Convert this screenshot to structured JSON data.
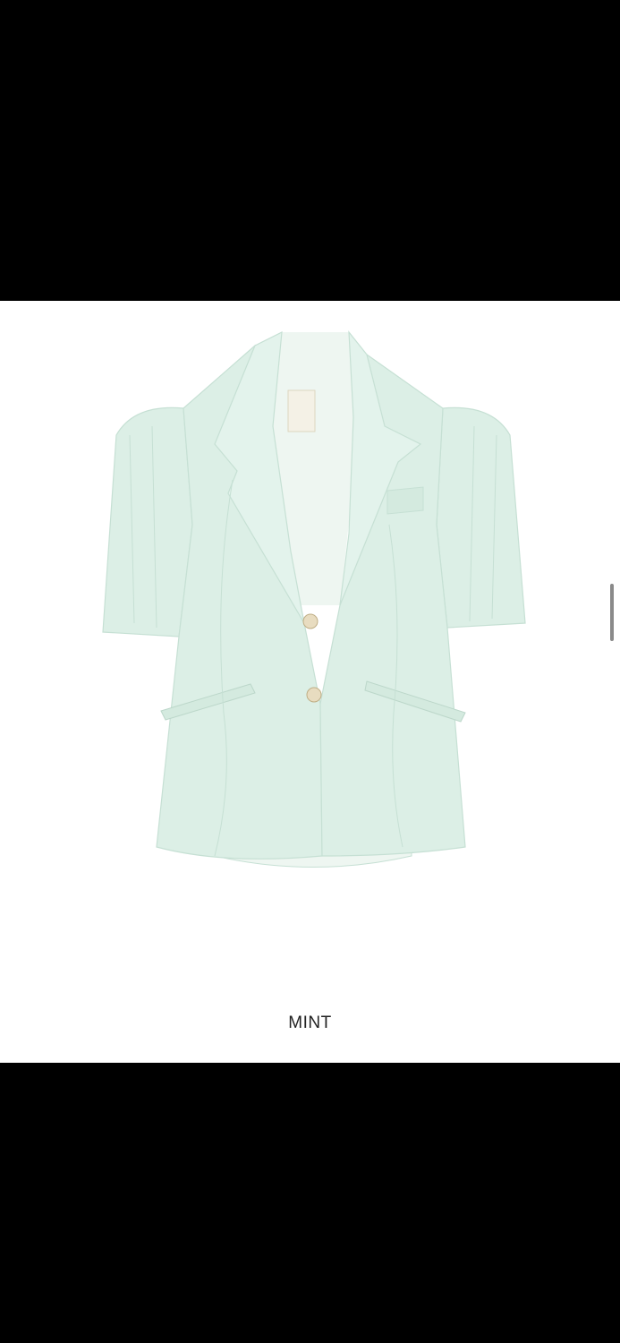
{
  "product": {
    "color_name": "MINT",
    "image_icon": "blazer-image",
    "colors": {
      "fabric": "#dcefe6",
      "fabric_shadow": "#c6e0d4",
      "lining": "#eef6f1",
      "button": "#e8dcc0"
    }
  }
}
